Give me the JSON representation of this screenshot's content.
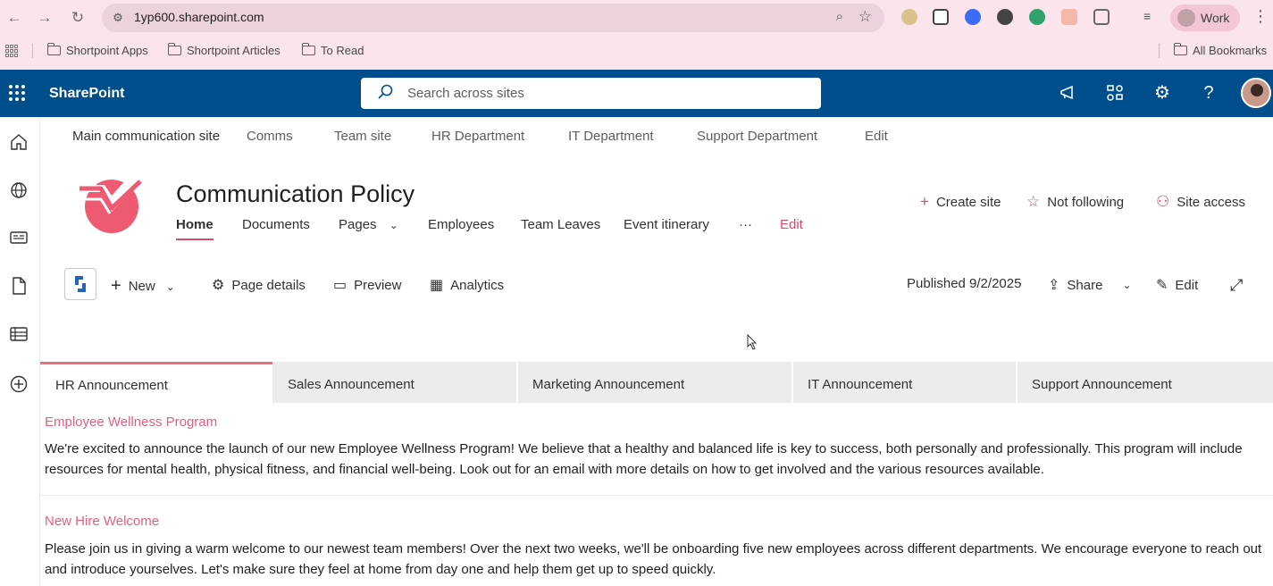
{
  "browser": {
    "url": "1yp600.sharepoint.com",
    "profile_label": "Work",
    "bookmarks": [
      "Shortpoint Apps",
      "Shortpoint Articles",
      "To Read"
    ],
    "all_bookmarks_label": "All Bookmarks"
  },
  "suite": {
    "app_name": "SharePoint",
    "search_placeholder": "Search across sites"
  },
  "hub_nav": {
    "items": [
      "Main communication site",
      "Comms",
      "Team site",
      "HR Department",
      "IT Department",
      "Support Department",
      "Edit"
    ]
  },
  "site": {
    "title": "Communication Policy",
    "nav": [
      "Home",
      "Documents",
      "Pages",
      "Employees",
      "Team Leaves",
      "Event itinerary",
      "···",
      "Edit"
    ],
    "actions": {
      "create_site": "Create site",
      "not_following": "Not following",
      "site_access": "Site access"
    }
  },
  "command_bar": {
    "new": "New",
    "page_details": "Page details",
    "preview": "Preview",
    "analytics": "Analytics",
    "published": "Published 9/2/2025",
    "share": "Share",
    "edit": "Edit"
  },
  "tabs": [
    "HR Announcement",
    "Sales Announcement",
    "Marketing Announcement",
    "IT Announcement",
    "Support Announcement"
  ],
  "announcements": [
    {
      "title": "Employee Wellness Program",
      "body": "We're excited to announce the launch of our new Employee Wellness Program! We believe that a healthy and balanced life is key to success, both personally and professionally. This program will include resources for mental health, physical fitness, and financial well-being. Look out for an email with more details on how to get involved and the various resources available."
    },
    {
      "title": "New Hire Welcome",
      "body": "Please join us in giving a warm welcome to our newest team members! Over the next two weeks, we'll be onboarding five new employees across different departments. We encourage everyone to reach out and introduce yourselves. Let's make sure they feel at home from day one and help them get up to speed quickly."
    }
  ],
  "colors": {
    "suite_bar": "#004e8c",
    "accent": "#d94a68",
    "browser_bar": "#fbe4ec"
  }
}
